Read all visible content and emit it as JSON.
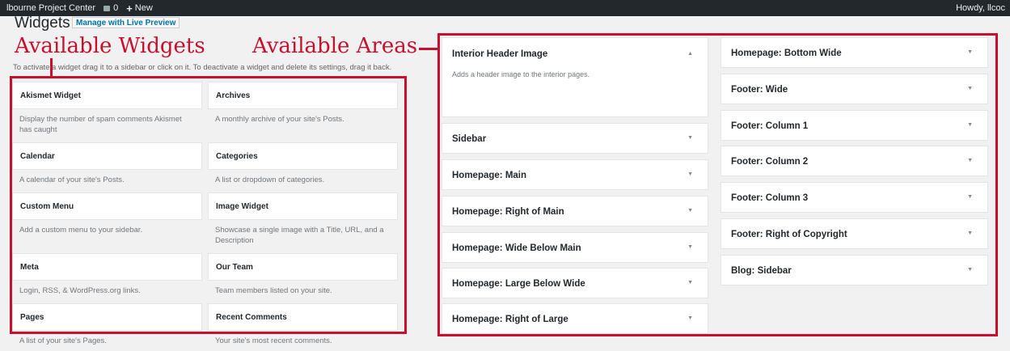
{
  "adminbar": {
    "site": "lbourne Project Center",
    "comments": "0",
    "new_label": "New",
    "howdy": "Howdy, llcoc"
  },
  "page": {
    "title": "Widgets",
    "live_preview": "Manage with Live Preview",
    "hint": "To activate a widget drag it to a sidebar or click on it. To deactivate a widget and delete its settings, drag it back."
  },
  "labels": {
    "available_widgets": "Available Widgets",
    "available_areas": "Available Areas"
  },
  "widgets": [
    {
      "title": "Akismet Widget",
      "desc": "Display the number of spam comments Akismet has caught"
    },
    {
      "title": "Archives",
      "desc": "A monthly archive of your site's Posts."
    },
    {
      "title": "Calendar",
      "desc": "A calendar of your site's Posts."
    },
    {
      "title": "Categories",
      "desc": "A list or dropdown of categories."
    },
    {
      "title": "Custom Menu",
      "desc": "Add a custom menu to your sidebar."
    },
    {
      "title": "Image Widget",
      "desc": "Showcase a single image with a Title, URL, and a Description"
    },
    {
      "title": "Meta",
      "desc": "Login, RSS, & WordPress.org links."
    },
    {
      "title": "Our Team",
      "desc": "Team members listed on your site."
    },
    {
      "title": "Pages",
      "desc": "A list of your site's Pages."
    },
    {
      "title": "Recent Comments",
      "desc": "Your site's most recent comments."
    }
  ],
  "areas_left": [
    {
      "title": "Interior Header Image",
      "desc": "Adds a header image to the interior pages.",
      "arrow": "▲"
    },
    {
      "title": "Sidebar",
      "arrow": "▼"
    },
    {
      "title": "Homepage: Main",
      "arrow": "▼"
    },
    {
      "title": "Homepage: Right of Main",
      "arrow": "▼"
    },
    {
      "title": "Homepage: Wide Below Main",
      "arrow": "▼"
    },
    {
      "title": "Homepage: Large Below Wide",
      "arrow": "▼"
    },
    {
      "title": "Homepage: Right of Large",
      "arrow": "▼"
    }
  ],
  "areas_right": [
    {
      "title": "Homepage: Bottom Wide",
      "arrow": "▼"
    },
    {
      "title": "Footer: Wide",
      "arrow": "▼"
    },
    {
      "title": "Footer: Column 1",
      "arrow": "▼"
    },
    {
      "title": "Footer: Column 2",
      "arrow": "▼"
    },
    {
      "title": "Footer: Column 3",
      "arrow": "▼"
    },
    {
      "title": "Footer: Right of Copyright",
      "arrow": "▼"
    },
    {
      "title": "Blog: Sidebar",
      "arrow": "▼"
    }
  ]
}
